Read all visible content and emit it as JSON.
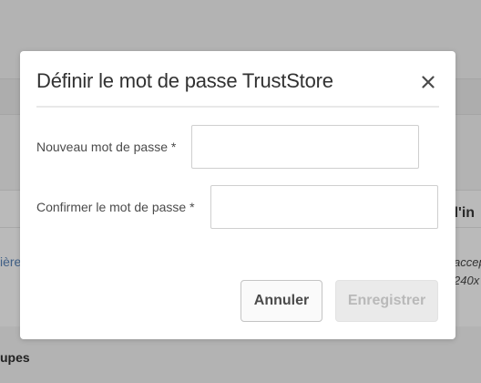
{
  "background": {
    "left_link_fragment": "ière",
    "right_heading_fragment": "er l'in",
    "right_italic_line1": "accep",
    "right_italic_line2": "240x",
    "bottom_heading_fragment": "upes"
  },
  "dialog": {
    "title": "Définir le mot de passe TrustStore",
    "close_icon": "close-icon",
    "fields": {
      "new_password_label": "Nouveau mot de passe *",
      "new_password_value": "",
      "confirm_password_label": "Confirmer le mot de passe *",
      "confirm_password_value": ""
    },
    "buttons": {
      "cancel_label": "Annuler",
      "save_label": "Enregistrer"
    }
  },
  "colors": {
    "overlay": "#b3b3b3",
    "dialog_bg": "#ffffff",
    "title_text": "#323232",
    "label_text": "#4b4b4b",
    "disabled_text": "#b9b9b9"
  }
}
